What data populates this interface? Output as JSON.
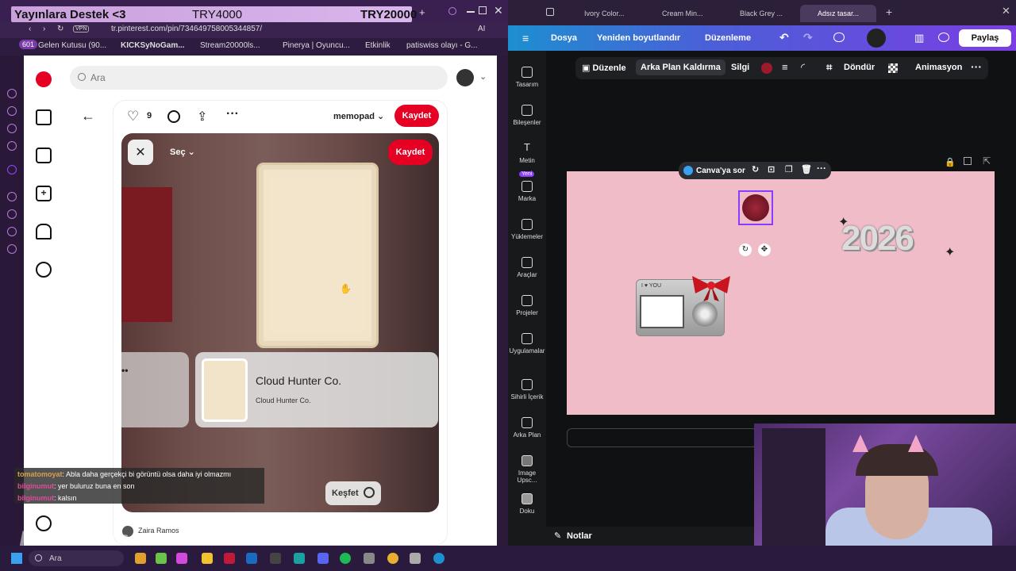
{
  "overlay": {
    "left_text": "Yayınlara Destek <3",
    "mid_text": "TRY4000",
    "right_text": "TRY20000"
  },
  "left_browser": {
    "url": "tr.pinterest.com/pin/734649758005344857/",
    "vpn_badge": "VPN",
    "ai_label": "AI",
    "badge_count": "601",
    "bookmarks": [
      "Gelen Kutusu (90...",
      "KICKSyNoGam...",
      "Stream20000ls...",
      "Pinerya | Oyuncu...",
      "Etkinlik",
      "patiswiss olayı - G..."
    ]
  },
  "pinterest": {
    "search_placeholder": "Ara",
    "like_count": "9",
    "board_name": "memopad",
    "save_label": "Kaydet",
    "select_label": "Seç",
    "source_title": "Cloud Hunter Co.",
    "source_subtitle": "Cloud Hunter Co.",
    "explore_label": "Keşfet",
    "author_name": "Zaira Ramos"
  },
  "chat": [
    {
      "user": "tomatomoyat",
      "message": ": Abla daha gerçekçi bi görüntü olsa daha iyi olmazmı"
    },
    {
      "user": "bilginumut",
      "message": ": yer buluruz buna en son"
    },
    {
      "user": "bilginumut",
      "message": ": kalsın"
    }
  ],
  "watermark": "DyNoGame",
  "right_browser": {
    "tabs": [
      "Ivory Color...",
      "Cream Min...",
      "Black Grey ...",
      "Adsız tasar..."
    ]
  },
  "canva": {
    "menu_file": "Dosya",
    "menu_resize": "Yeniden boyutlandır",
    "menu_edit": "Düzenleme",
    "share_label": "Paylaş",
    "toolbar": [
      "Düzenle",
      "Arka Plan Kaldırma",
      "Silgi",
      "Döndür",
      "Animasyon"
    ],
    "ask_canva": "Canva'ya sor",
    "year_text": "2026",
    "new_badge": "Yeni",
    "sidebar": [
      "Tasarım",
      "Bileşenler",
      "Metin",
      "Marka",
      "Yüklemeler",
      "Araçlar",
      "Projeler",
      "Uygulamalar",
      "Sihirli İçerik",
      "Arka Plan",
      "Image Upsc...",
      "Doku"
    ],
    "notes_label": "Notlar",
    "camera_label": "I ♥ YOU"
  },
  "taskbar": {
    "search_placeholder": "Ara"
  }
}
